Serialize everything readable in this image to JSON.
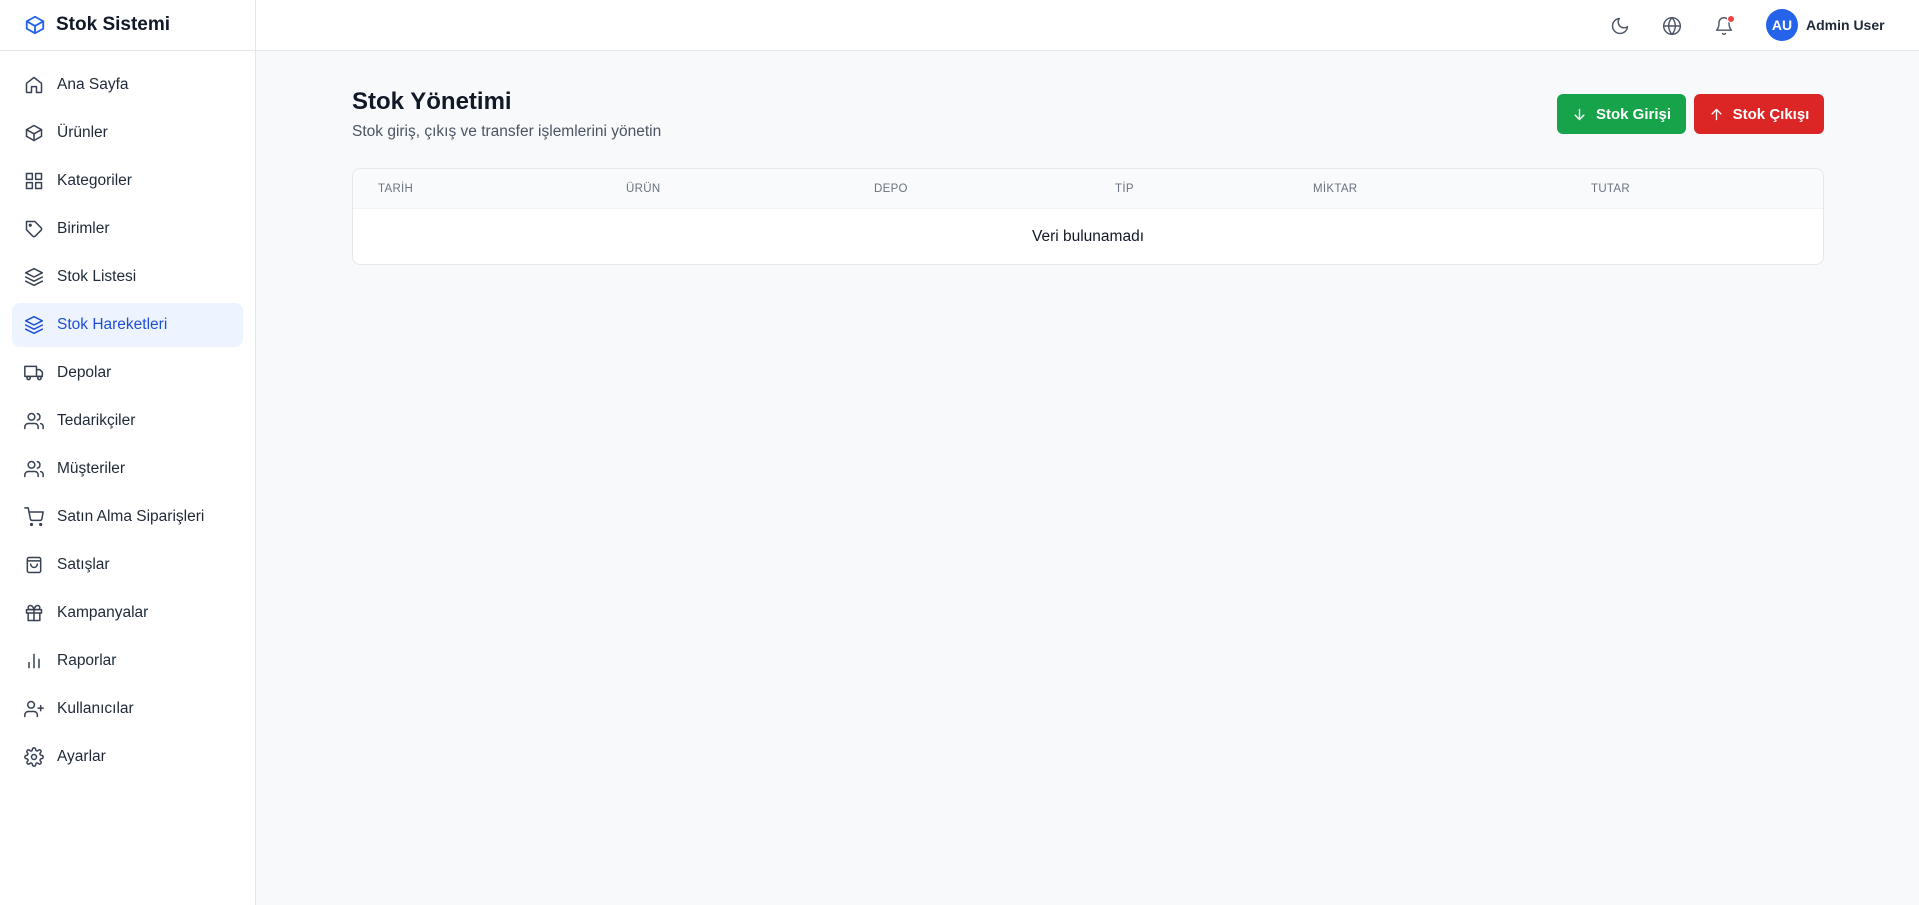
{
  "app": {
    "brand": "Stok Sistemi"
  },
  "sidebar": {
    "items": [
      {
        "label": "Ana Sayfa",
        "icon": "home-icon"
      },
      {
        "label": "Ürünler",
        "icon": "box-icon"
      },
      {
        "label": "Kategoriler",
        "icon": "grid-icon"
      },
      {
        "label": "Birimler",
        "icon": "tag-icon"
      },
      {
        "label": "Stok Listesi",
        "icon": "layers-icon"
      },
      {
        "label": "Stok Hareketleri",
        "icon": "layers-icon",
        "active": true
      },
      {
        "label": "Depolar",
        "icon": "truck-icon"
      },
      {
        "label": "Tedarikçiler",
        "icon": "users-icon"
      },
      {
        "label": "Müşteriler",
        "icon": "users-icon"
      },
      {
        "label": "Satın Alma Siparişleri",
        "icon": "cart-icon"
      },
      {
        "label": "Satışlar",
        "icon": "shopping-bag-icon"
      },
      {
        "label": "Kampanyalar",
        "icon": "gift-icon"
      },
      {
        "label": "Raporlar",
        "icon": "bar-chart-icon"
      },
      {
        "label": "Kullanıcılar",
        "icon": "user-plus-icon"
      },
      {
        "label": "Ayarlar",
        "icon": "settings-icon"
      }
    ]
  },
  "topbar": {
    "user": {
      "initials": "AU",
      "name": "Admin User"
    },
    "has_notification": true
  },
  "page": {
    "title": "Stok Yönetimi",
    "subtitle": "Stok giriş, çıkış ve transfer işlemlerini yönetin",
    "actions": {
      "stock_in": "Stok Girişi",
      "stock_out": "Stok Çıkışı"
    }
  },
  "table": {
    "columns": [
      "TARİH",
      "ÜRÜN",
      "DEPO",
      "TİP",
      "MİKTAR",
      "TUTAR"
    ],
    "empty_message": "Veri bulunamadı"
  },
  "colors": {
    "primary": "#2563eb",
    "success": "#16a34a",
    "danger": "#dc2626",
    "active_bg": "#eef4ff"
  }
}
